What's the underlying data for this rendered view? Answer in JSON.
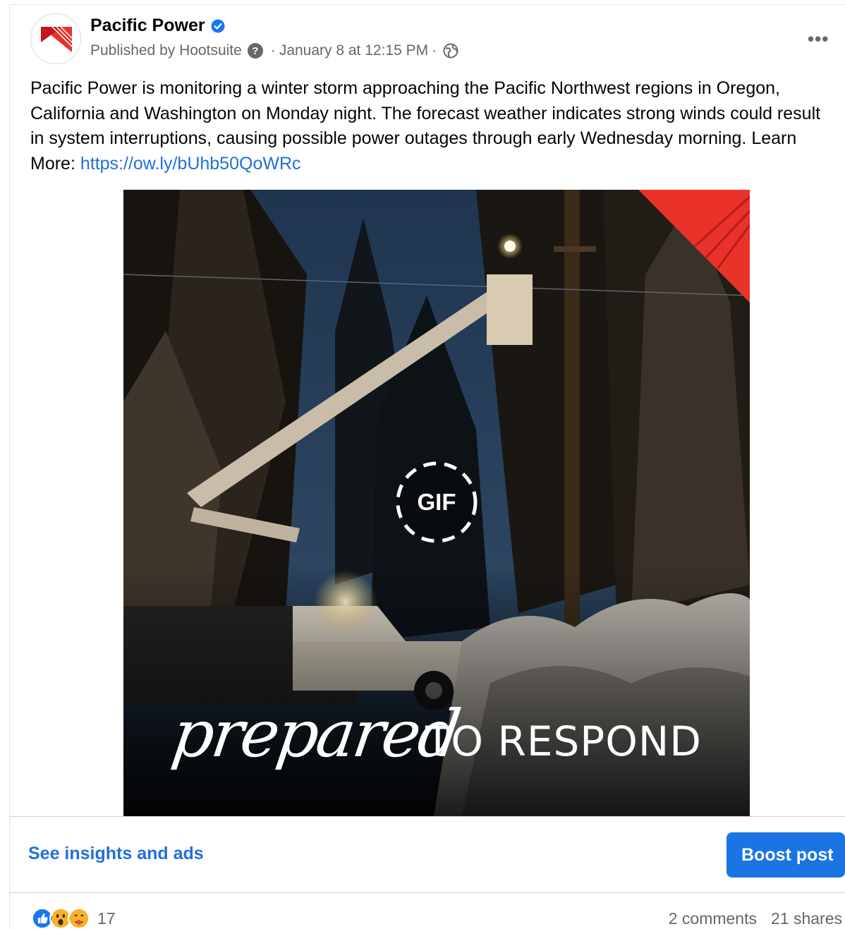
{
  "post": {
    "page_name": "Pacific Power",
    "published_by": "Published by Hootsuite",
    "help_glyph": "?",
    "date": "January 8 at 12:15 PM",
    "separator": "·",
    "more_label": "•••",
    "text": "Pacific Power is monitoring a winter storm approaching the Pacific Northwest regions in Oregon, California and Washington on Monday night. The forecast weather indicates strong winds could result in system interruptions, causing possible power outages through early Wednesday morning. Learn More: ",
    "link": "https://ow.ly/bUhb50QoWRc"
  },
  "media": {
    "gif_label": "GIF",
    "tagline_script": "prepared",
    "tagline_caps": "TO RESPOND"
  },
  "actions": {
    "insights_label": "See insights and ads",
    "boost_label": "Boost post"
  },
  "engagement": {
    "reaction_count": "17",
    "comments": "2 comments",
    "shares": "21 shares"
  },
  "icons": {
    "verified": "verified-badge-icon",
    "globe": "globe-icon",
    "like": "like-reaction-icon",
    "wow": "wow-reaction-icon",
    "care": "care-reaction-icon"
  },
  "colors": {
    "brand_red": "#e8322a",
    "link_blue": "#216fdb",
    "button_blue": "#1b74e4"
  }
}
